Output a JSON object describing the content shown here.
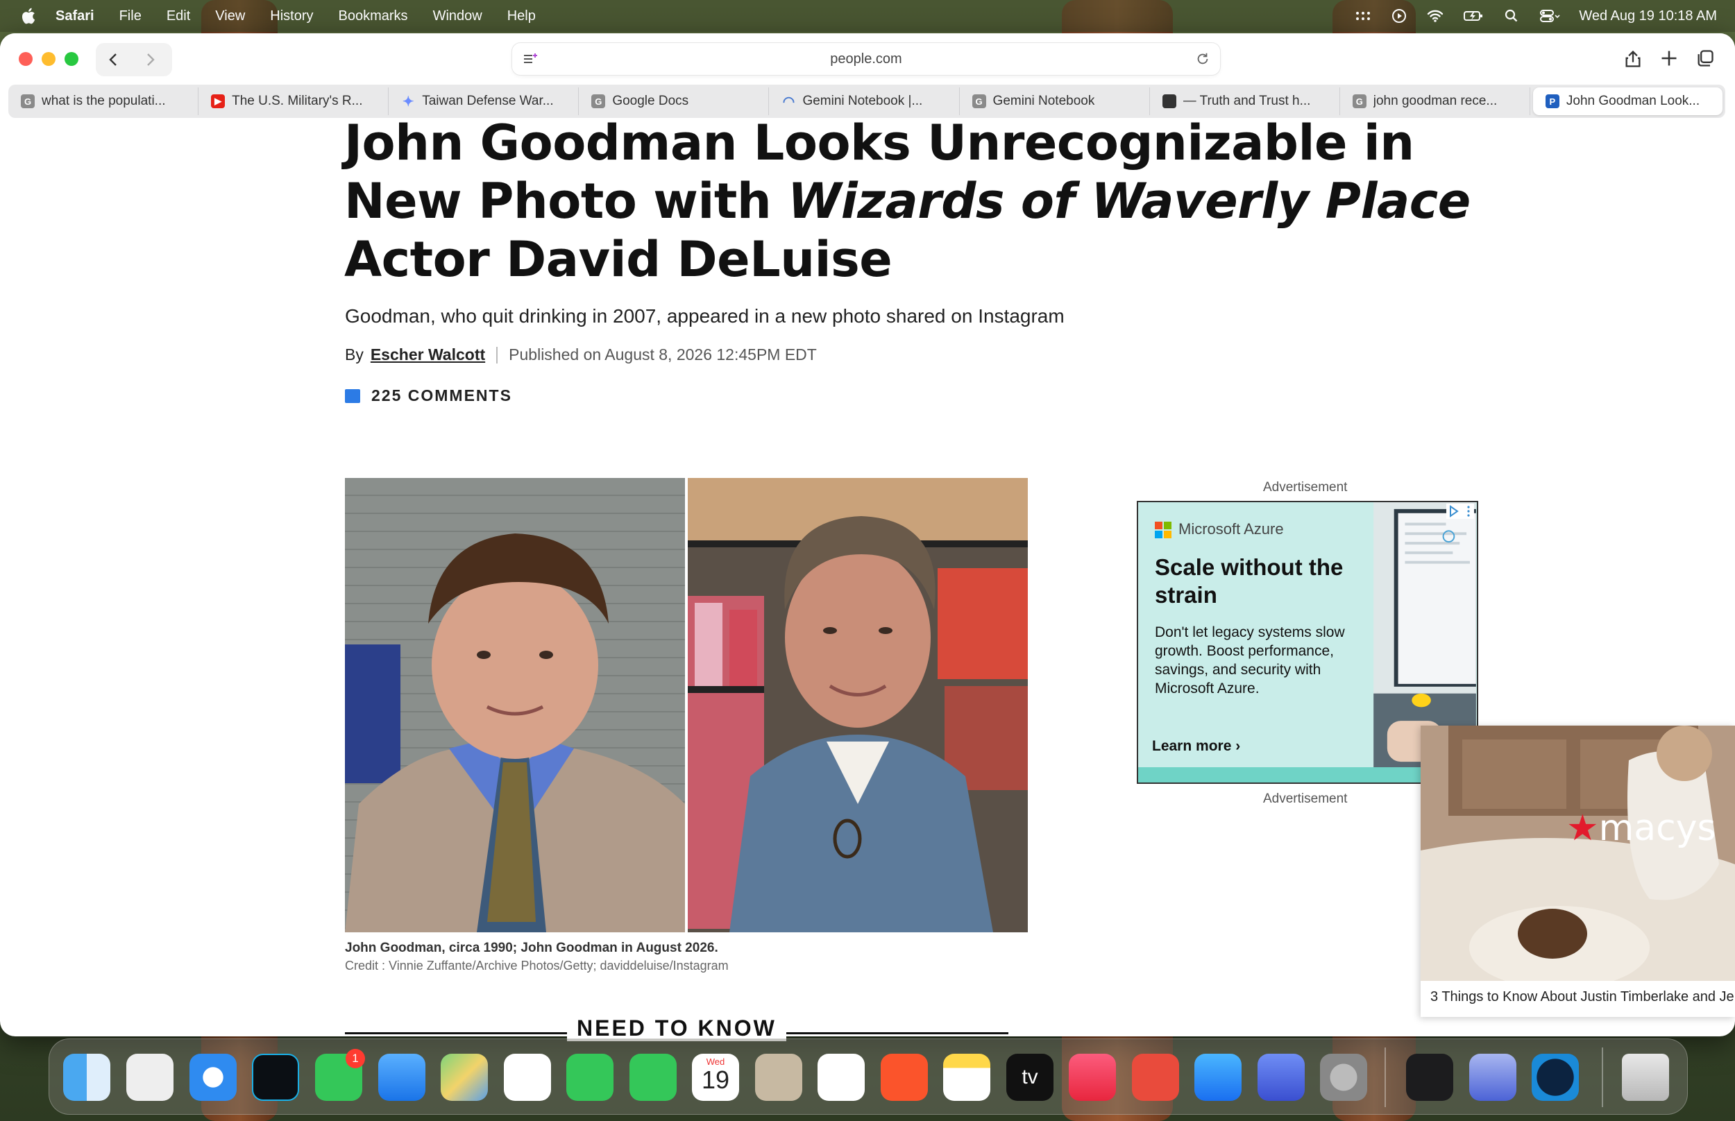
{
  "menubar": {
    "app": "Safari",
    "menus": [
      "File",
      "Edit",
      "View",
      "History",
      "Bookmarks",
      "Window",
      "Help"
    ],
    "datetime": "Wed Aug 19  10:18 AM"
  },
  "browser": {
    "url": "people.com",
    "tabs": [
      {
        "label": "what is the populati...",
        "icon": "google-icon",
        "color": "#8a8a8a"
      },
      {
        "label": "The U.S. Military's R...",
        "icon": "youtube-icon",
        "color": "#e62117"
      },
      {
        "label": "Taiwan Defense War...",
        "icon": "gemini-icon",
        "color": "#6b8cff"
      },
      {
        "label": "Google Docs",
        "icon": "google-icon",
        "color": "#8a8a8a"
      },
      {
        "label": "Gemini Notebook |...",
        "icon": "notebook-icon",
        "color": "#4a7bd0"
      },
      {
        "label": "Gemini Notebook",
        "icon": "google-icon",
        "color": "#8a8a8a"
      },
      {
        "label": "— Truth and Trust h...",
        "icon": "cube-icon",
        "color": "#333333"
      },
      {
        "label": "john goodman rece...",
        "icon": "google-icon",
        "color": "#8a8a8a"
      },
      {
        "label": "John Goodman Look...",
        "icon": "people-icon",
        "color": "#1f5fbf"
      }
    ]
  },
  "article": {
    "headline_part1": "John Goodman Looks Unrecognizable in New Photo with ",
    "headline_italic": "Wizards of Waverly Place",
    "headline_part2": " Actor David DeLuise",
    "dek": "Goodman, who quit drinking in 2007, appeared in a new photo shared on Instagram",
    "by": "By",
    "author": "Escher Walcott",
    "published": "Published on August 8, 2026 12:45PM EDT",
    "comments": "225 COMMENTS",
    "caption": "John Goodman, circa 1990; John Goodman in August 2026.",
    "credit": "Credit : Vinnie Zuffante/Archive Photos/Getty; daviddeluise/Instagram",
    "need_to_know": "NEED TO KNOW"
  },
  "ads": {
    "label": "Advertisement",
    "azure": {
      "brand": "Microsoft Azure",
      "headline": "Scale without the strain",
      "body": "Don't let legacy systems slow growth. Boost performance, savings, and security with Microsoft Azure.",
      "cta": "Learn more"
    },
    "macys": {
      "logo": "macys",
      "text": "3 Things to Know About Justin Timberlake and Je"
    }
  },
  "dock": {
    "badge_messages": "1",
    "calendar_day": "Wed",
    "calendar_date": "19",
    "tv_label": "tv"
  }
}
